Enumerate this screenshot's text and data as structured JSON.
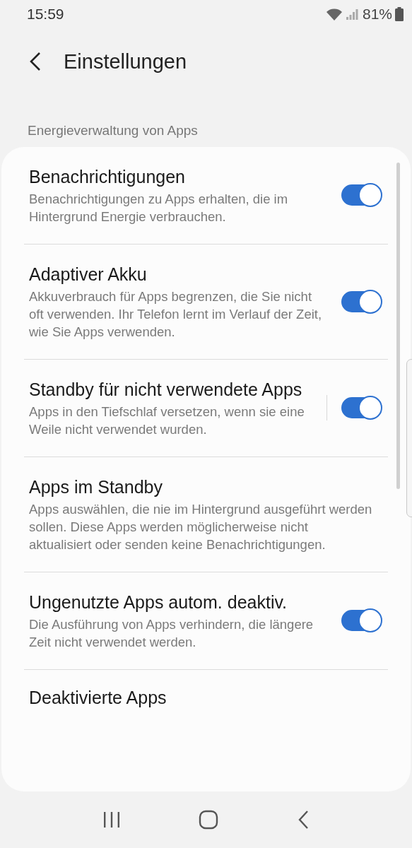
{
  "status_bar": {
    "time": "15:59",
    "battery_percent": "81%"
  },
  "header": {
    "title": "Einstellungen"
  },
  "section": {
    "title": "Energieverwaltung von Apps"
  },
  "items": [
    {
      "kind": "toggle",
      "title": "Benachrichtigungen",
      "description": "Benachrichtigungen zu Apps erhalten, die im Hintergrund Energie verbrauchen.",
      "on": true
    },
    {
      "kind": "toggle",
      "title": "Adaptiver Akku",
      "description": "Akkuverbrauch für Apps begrenzen, die Sie nicht oft verwenden. Ihr Telefon lernt im Verlauf der Zeit, wie Sie Apps verwenden.",
      "on": true
    },
    {
      "kind": "split-toggle",
      "title": "Standby für nicht verwendete Apps",
      "description": "Apps in den Tiefschlaf versetzen, wenn sie eine Weile nicht verwendet wurden.",
      "on": true
    },
    {
      "kind": "link",
      "title": "Apps im Standby",
      "description": "Apps auswählen, die nie im Hintergrund ausgeführt werden sollen. Diese Apps werden möglicherweise nicht aktualisiert oder senden keine Benachrichtigungen."
    },
    {
      "kind": "toggle",
      "title": "Ungenutzte Apps autom. deaktiv.",
      "description": "Die Ausführung von Apps verhindern, die längere Zeit nicht verwendet werden.",
      "on": true
    },
    {
      "kind": "link",
      "title": "Deaktivierte Apps"
    }
  ]
}
